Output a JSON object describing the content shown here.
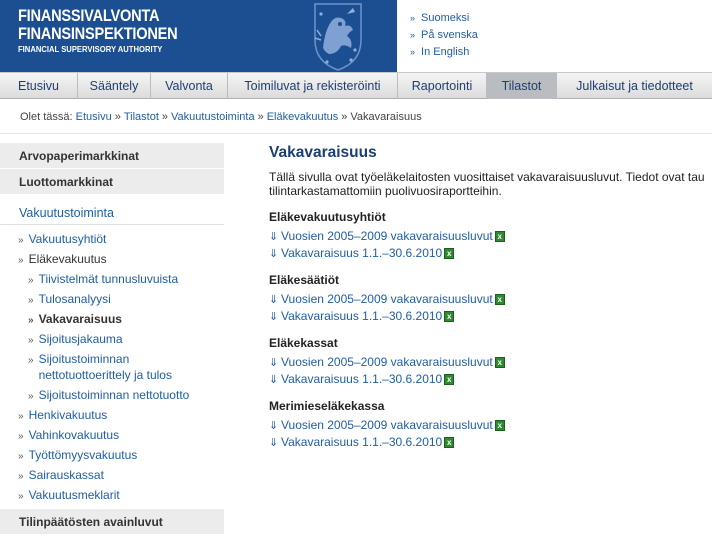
{
  "brand": {
    "line1": "FINANSSIVALVONTA",
    "line2": "FINANSINSPEKTIONEN",
    "line3": "FINANCIAL SUPERVISORY AUTHORITY",
    "color": "#1c4e92"
  },
  "languages": [
    {
      "label": "Suomeksi"
    },
    {
      "label": "På svenska"
    },
    {
      "label": "In English"
    }
  ],
  "nav": [
    {
      "label": "Etusivu"
    },
    {
      "label": "Sääntely"
    },
    {
      "label": "Valvonta"
    },
    {
      "label": "Toimiluvat ja rekisteröinti"
    },
    {
      "label": "Raportointi"
    },
    {
      "label": "Tilastot",
      "active": true
    },
    {
      "label": "Julkaisut ja tiedotteet"
    }
  ],
  "breadcrumb": {
    "prefix": "Olet tässä:",
    "items": [
      "Etusivu",
      "Tilastot",
      "Vakuutustoiminta",
      "Eläkevakuutus"
    ],
    "current": "Vakavaraisuus",
    "separator": "»"
  },
  "sidebar": {
    "sections": [
      "Arvopaperimarkkinat",
      "Luottomarkkinat"
    ],
    "heading": "Vakuutustoiminta",
    "items": [
      {
        "label": "Vakuutusyhtiöt",
        "level": 1
      },
      {
        "label": "Eläkevakuutus",
        "level": 1,
        "open": true
      },
      {
        "label": "Tiivistelmät tunnusluvuista",
        "level": 2
      },
      {
        "label": "Tulosanalyysi",
        "level": 2
      },
      {
        "label": "Vakavaraisuus",
        "level": 2,
        "current": true
      },
      {
        "label": "Sijoitusjakauma",
        "level": 2
      },
      {
        "label": "Sijoitustoiminnan nettotuottoerittely ja tulos",
        "level": 2
      },
      {
        "label": "Sijoitustoiminnan nettotuotto",
        "level": 2
      },
      {
        "label": "Henkivakuutus",
        "level": 1
      },
      {
        "label": "Vahinkovakuutus",
        "level": 1
      },
      {
        "label": "Työttömyysvakuutus",
        "level": 1
      },
      {
        "label": "Sairauskassat",
        "level": 1
      },
      {
        "label": "Vakuutusmeklarit",
        "level": 1
      }
    ],
    "bottom_section": "Tilinpäätösten avainluvut"
  },
  "main": {
    "title": "Vakavaraisuus",
    "intro_line1": "Tällä sivulla ovat työeläkelaitosten vuosittaiset vakavaraisuusluvut. Tiedot ovat tau",
    "intro_line2": "tilintarkastamattomiin puolivuosiraportteihin.",
    "sections": [
      {
        "title": "Eläkevakuutusyhtiöt",
        "links": [
          "Vuosien 2005–2009 vakavaraisuusluvut",
          "Vakavaraisuus 1.1.–30.6.2010"
        ]
      },
      {
        "title": "Eläkesäätiöt",
        "links": [
          "Vuosien 2005–2009 vakavaraisuusluvut",
          "Vakavaraisuus 1.1.–30.6.2010"
        ]
      },
      {
        "title": "Eläkekassat",
        "links": [
          "Vuosien 2005–2009 vakavaraisuusluvut",
          "Vakavaraisuus 1.1.–30.6.2010"
        ]
      },
      {
        "title": "Merimieseläkekassa",
        "links": [
          "Vuosien 2005–2009 vakavaraisuusluvut",
          "Vakavaraisuus 1.1.–30.6.2010"
        ]
      }
    ],
    "file_icon": "excel-file-icon",
    "xls_glyph": "x"
  }
}
